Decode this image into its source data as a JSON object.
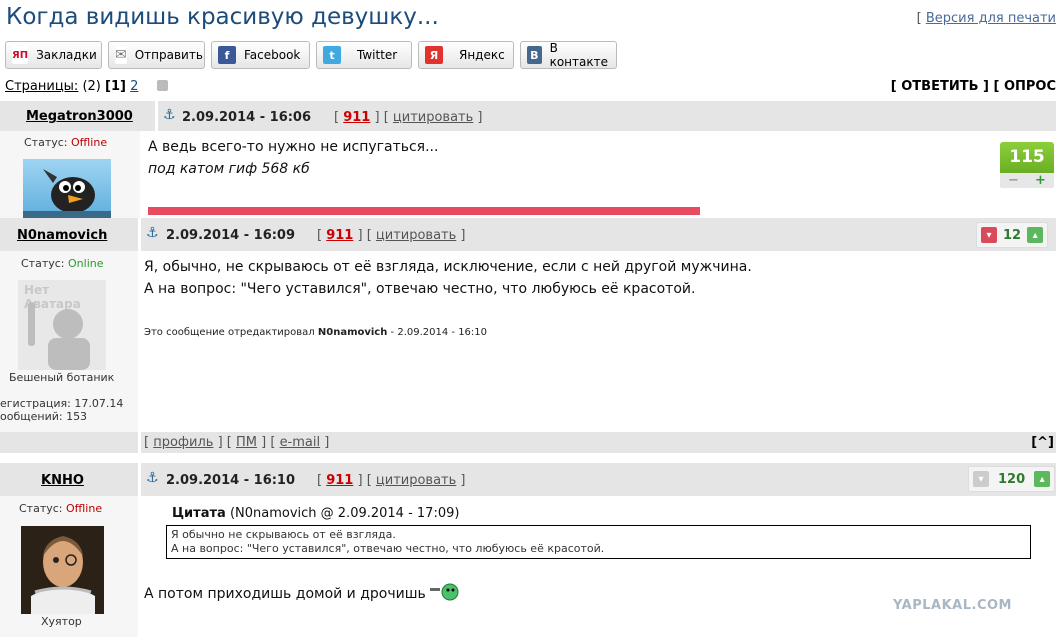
{
  "page": {
    "title": "Когда видишь красивую девушку...",
    "print_link": "Версия для печати",
    "share": [
      {
        "label": "Закладки",
        "icon": "yap-icon",
        "glyph": "ЯП",
        "color": "#c8102e"
      },
      {
        "label": "Отправить",
        "icon": "envelope-icon",
        "glyph": "✉",
        "color": "#888888"
      },
      {
        "label": "Facebook",
        "icon": "facebook-icon",
        "glyph": "f",
        "color": "#3b5998"
      },
      {
        "label": "Twitter",
        "icon": "twitter-icon",
        "glyph": "t",
        "color": "#3fa9e0"
      },
      {
        "label": "Яндекс",
        "icon": "yandex-icon",
        "glyph": "Я",
        "color": "#e0332d"
      },
      {
        "label": "В контакте",
        "icon": "vk-icon",
        "glyph": "В",
        "color": "#45688e"
      }
    ],
    "pages_label": "Страницы:",
    "pages_count": "(2)",
    "page_current": "[1]",
    "page_next": "2",
    "reply_links": "[ ОТВЕТИТЬ ] [ ОПРОС"
  },
  "posts": [
    {
      "user": "Megatron3000",
      "date": "2.09.2014 - 16:06",
      "num": "911",
      "quote": "цитировать",
      "status_label": "Статус:",
      "status": "Offline",
      "lines": [
        "А ведь всего-то нужно не испугаться...",
        "под катом гиф 568 кб"
      ],
      "rating": "115"
    },
    {
      "user": "N0namovich",
      "date": "2.09.2014 - 16:09",
      "num": "911",
      "quote": "цитировать",
      "status_label": "Статус:",
      "status": "Online",
      "no_avatar": "Нет Аватара",
      "rank": "Бешеный ботаник",
      "reg": "егистрация: 17.07.14",
      "msgs": "ообщений: 153",
      "lines": [
        "Я, обычно, не скрываюсь от её взгляда, исключение, если с ней другой мужчина.",
        "А на вопрос: \"Чего уставился\", отвечаю честно, что любуюсь её красотой."
      ],
      "edit_prefix": "Это сообщение отредактировал",
      "edit_user": "N0namovich",
      "edit_date": "- 2.09.2014 - 16:10",
      "rating": "12",
      "footer": [
        "профиль",
        "ПМ",
        "e-mail"
      ],
      "top_link": "[^]"
    },
    {
      "user": "KNHO",
      "date": "2.09.2014 - 16:10",
      "num": "911",
      "quote": "цитировать",
      "status_label": "Статус:",
      "status": "Offline",
      "rank": "Хуятор",
      "quote_title": "Цитата",
      "quote_meta": "(N0namovich @ 2.09.2014 - 17:09)",
      "quote_lines": [
        "Я обычно не скрываюсь от её взгляда.",
        "А на вопрос: \"Чего уставился\", отвечаю честно, что любуюсь её красотой."
      ],
      "line": "А потом приходишь домой и дрочишь",
      "rating": "120"
    }
  ],
  "watermark": "YAPLAKAL.COM"
}
